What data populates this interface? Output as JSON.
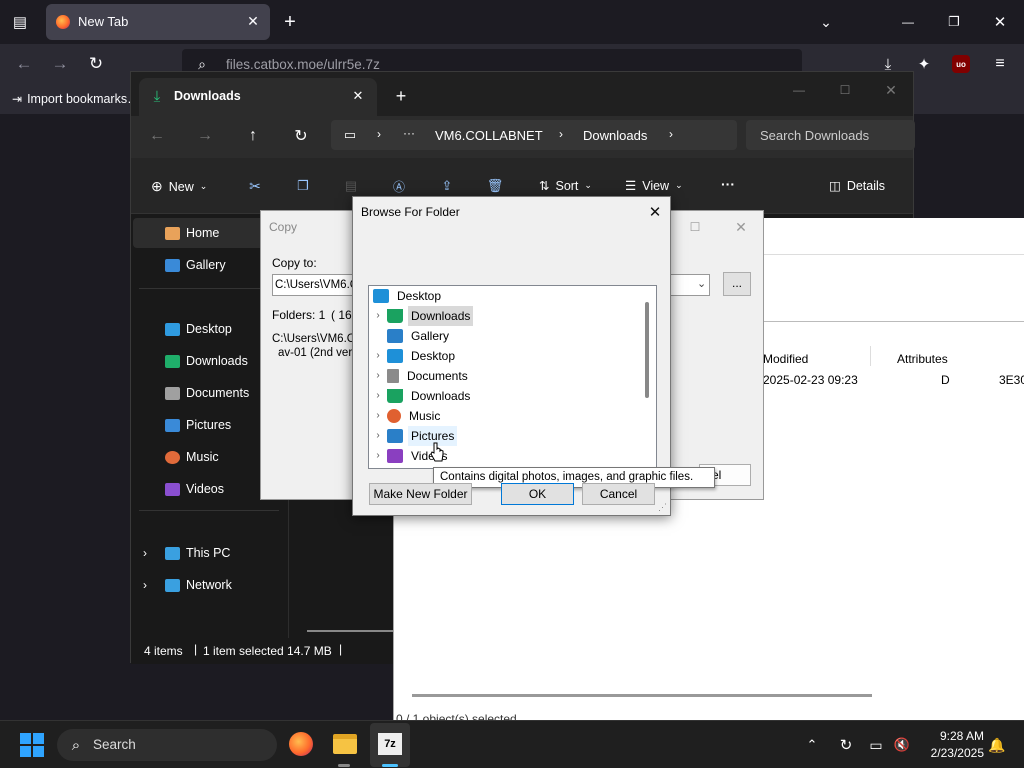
{
  "firefox": {
    "tab_title": "New Tab",
    "url": "files.catbox.moe/ulrr5e.7z",
    "bookmark": "Import bookmarks…",
    "accent": "#0060df"
  },
  "explorer": {
    "tab_title": "Downloads",
    "breadcrumb": [
      "VM6.COLLABNET",
      "Downloads"
    ],
    "search_placeholder": "Search Downloads",
    "commands": {
      "new": "New",
      "sort": "Sort",
      "view": "View",
      "details": "Details"
    },
    "sidebar": [
      {
        "label": "Home",
        "icon": "home-icon"
      },
      {
        "label": "Gallery",
        "icon": "gallery-icon"
      },
      {
        "label": "Desktop",
        "icon": "desktop-icon"
      },
      {
        "label": "Downloads",
        "icon": "download-icon"
      },
      {
        "label": "Documents",
        "icon": "documents-icon"
      },
      {
        "label": "Pictures",
        "icon": "pictures-icon"
      },
      {
        "label": "Music",
        "icon": "music-icon"
      },
      {
        "label": "Videos",
        "icon": "videos-icon"
      },
      {
        "label": "This PC",
        "icon": "pc-icon"
      },
      {
        "label": "Network",
        "icon": "network-icon"
      }
    ],
    "status": {
      "items": "4 items",
      "selected": "1 item selected 14.7 MB"
    }
  },
  "sevenzip": {
    "columns": {
      "modified": "Modified",
      "attributes": "Attributes"
    },
    "row": {
      "modified": "2025-02-23 09:23",
      "attributes": "D",
      "extra": "3E30"
    },
    "status": "0 / 1 object(s) selected"
  },
  "copy_dialog": {
    "title": "Copy",
    "copy_to_label": "Copy to:",
    "path": "C:\\Users\\VM6.C",
    "folders": "Folders: 1",
    "size_fragment": "( 16 5",
    "source_line1": "C:\\Users\\VM6.C",
    "source_line2": "av-01 (2nd versi",
    "browse_button": "...",
    "cancel_fragment": "el"
  },
  "browse_dialog": {
    "title": "Browse For Folder",
    "tree": [
      {
        "label": "Desktop",
        "level": 0,
        "expandable": false,
        "icon": "desktop-icon",
        "color": "#1e90d8"
      },
      {
        "label": "Downloads",
        "level": 1,
        "expandable": true,
        "icon": "download-icon",
        "color": "#1aa260",
        "selected": true
      },
      {
        "label": "Gallery",
        "level": 1,
        "expandable": false,
        "icon": "gallery-icon",
        "color": "#2a7fc8"
      },
      {
        "label": "Desktop",
        "level": 1,
        "expandable": true,
        "icon": "desktop-icon",
        "color": "#1e90d8"
      },
      {
        "label": "Documents",
        "level": 1,
        "expandable": true,
        "icon": "documents-icon",
        "color": "#8a8a8a"
      },
      {
        "label": "Downloads",
        "level": 1,
        "expandable": true,
        "icon": "download-icon",
        "color": "#1aa260"
      },
      {
        "label": "Music",
        "level": 1,
        "expandable": true,
        "icon": "music-icon",
        "color": "#e06030"
      },
      {
        "label": "Pictures",
        "level": 1,
        "expandable": true,
        "icon": "pictures-icon",
        "color": "#2a7fc8",
        "hover": true
      },
      {
        "label": "Videos",
        "level": 1,
        "expandable": true,
        "icon": "videos-icon",
        "color": "#8a3fc0"
      }
    ],
    "tooltip": "Contains digital photos, images, and graphic files.",
    "make_folder": "Make New Folder",
    "ok": "OK",
    "cancel": "Cancel"
  },
  "taskbar": {
    "search": "Search",
    "time": "9:28 AM",
    "date": "2/23/2025"
  }
}
